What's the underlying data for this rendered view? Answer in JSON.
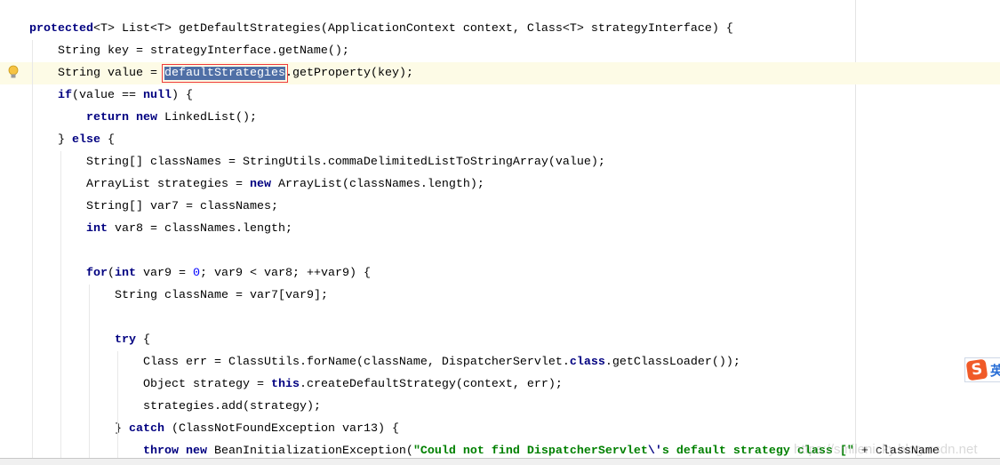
{
  "editor": {
    "lines": [
      {
        "indent": 0,
        "tokens": [
          [
            "kw",
            "protected"
          ],
          [
            "",
            "<T> List<T> getDefaultStrategies(ApplicationContext context, Class<T> strategyInterface) {"
          ]
        ]
      },
      {
        "indent": 1,
        "tokens": [
          [
            "",
            "String key = strategyInterface.getName();"
          ]
        ]
      },
      {
        "indent": 1,
        "current": true,
        "tokens": [
          [
            "",
            "String value = "
          ],
          [
            "sel",
            "defaultStrategies"
          ],
          [
            "",
            ".getProperty(key);"
          ]
        ]
      },
      {
        "indent": 1,
        "tokens": [
          [
            "kw",
            "if"
          ],
          [
            "",
            "(value == "
          ],
          [
            "kw",
            "null"
          ],
          [
            "",
            ") {"
          ]
        ]
      },
      {
        "indent": 2,
        "tokens": [
          [
            "kw",
            "return new"
          ],
          [
            "",
            " LinkedList();"
          ]
        ]
      },
      {
        "indent": 1,
        "tokens": [
          [
            "",
            "} "
          ],
          [
            "kw",
            "else"
          ],
          [
            "",
            " {"
          ]
        ]
      },
      {
        "indent": 2,
        "tokens": [
          [
            "",
            "String[] classNames = StringUtils.commaDelimitedListToStringArray(value);"
          ]
        ]
      },
      {
        "indent": 2,
        "tokens": [
          [
            "",
            "ArrayList strategies = "
          ],
          [
            "kw",
            "new"
          ],
          [
            "",
            " ArrayList(classNames.length);"
          ]
        ]
      },
      {
        "indent": 2,
        "tokens": [
          [
            "",
            "String[] var7 = classNames;"
          ]
        ]
      },
      {
        "indent": 2,
        "tokens": [
          [
            "kw",
            "int"
          ],
          [
            "",
            " var8 = classNames.length;"
          ]
        ]
      },
      {
        "indent": 0,
        "tokens": []
      },
      {
        "indent": 2,
        "tokens": [
          [
            "kw",
            "for"
          ],
          [
            "",
            "("
          ],
          [
            "kw",
            "int"
          ],
          [
            "",
            " var9 = "
          ],
          [
            "num",
            "0"
          ],
          [
            "",
            "; var9 < var8; ++var9) {"
          ]
        ]
      },
      {
        "indent": 3,
        "tokens": [
          [
            "",
            "String className = var7[var9];"
          ]
        ]
      },
      {
        "indent": 0,
        "tokens": []
      },
      {
        "indent": 3,
        "tokens": [
          [
            "kw",
            "try"
          ],
          [
            "",
            " {"
          ]
        ]
      },
      {
        "indent": 4,
        "tokens": [
          [
            "",
            "Class err = ClassUtils.forName(className, DispatcherServlet."
          ],
          [
            "kw",
            "class"
          ],
          [
            "",
            ".getClassLoader());"
          ]
        ]
      },
      {
        "indent": 4,
        "tokens": [
          [
            "",
            "Object strategy = "
          ],
          [
            "kw",
            "this"
          ],
          [
            "",
            ".createDefaultStrategy(context, err);"
          ]
        ]
      },
      {
        "indent": 4,
        "tokens": [
          [
            "",
            "strategies.add(strategy);"
          ]
        ]
      },
      {
        "indent": 3,
        "tokens": [
          [
            "",
            "} "
          ],
          [
            "kw",
            "catch"
          ],
          [
            "",
            " (ClassNotFoundException var13) {"
          ]
        ]
      },
      {
        "indent": 4,
        "tokens": [
          [
            "kw",
            "throw new"
          ],
          [
            "",
            " BeanInitializationException("
          ],
          [
            "str",
            "\"Could not find DispatcherServlet"
          ],
          [
            "kw",
            "\\'"
          ],
          [
            "str",
            "s default strategy class ["
          ],
          [
            "str",
            "\""
          ],
          [
            "",
            " + className"
          ]
        ]
      }
    ]
  },
  "gutter": {
    "intention_icon": "lightbulb-icon"
  },
  "ime": {
    "logo": "S",
    "language": "英"
  },
  "watermark": "https://smilenicky.blog.csdn.net"
}
